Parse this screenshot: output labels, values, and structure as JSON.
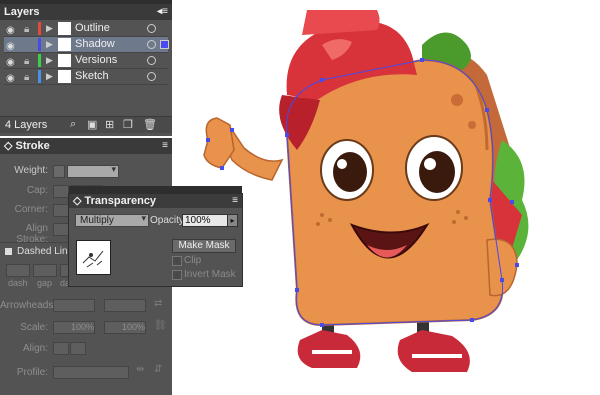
{
  "layers_panel": {
    "tab": "Layers",
    "layers": [
      {
        "name": "Outline",
        "color": "#e8473c",
        "selected": false
      },
      {
        "name": "Shadow",
        "color": "#4a4ae8",
        "selected": true
      },
      {
        "name": "Versions",
        "color": "#3bd04a",
        "selected": false
      },
      {
        "name": "Sketch",
        "color": "#4a90e8",
        "selected": false
      }
    ],
    "count": "4 Layers"
  },
  "stroke_panel": {
    "tab": "Stroke",
    "weight_label": "Weight:",
    "cap_label": "Cap:",
    "corner_label": "Corner:",
    "align_label": "Align Stroke:",
    "dashed_label": "Dashed Line",
    "dash_labels": [
      "dash",
      "gap",
      "dash"
    ],
    "arrowheads_label": "Arrowheads:",
    "scale_label": "Scale:",
    "scale_values": [
      "100%",
      "100%"
    ],
    "align_label2": "Align:",
    "profile_label": "Profile:"
  },
  "transparency_panel": {
    "tab": "Transparency",
    "blend_mode": "Multiply",
    "opacity_label": "Opacity:",
    "opacity_value": "100%",
    "make_mask": "Make Mask",
    "clip": "Clip",
    "invert_mask": "Invert Mask"
  }
}
